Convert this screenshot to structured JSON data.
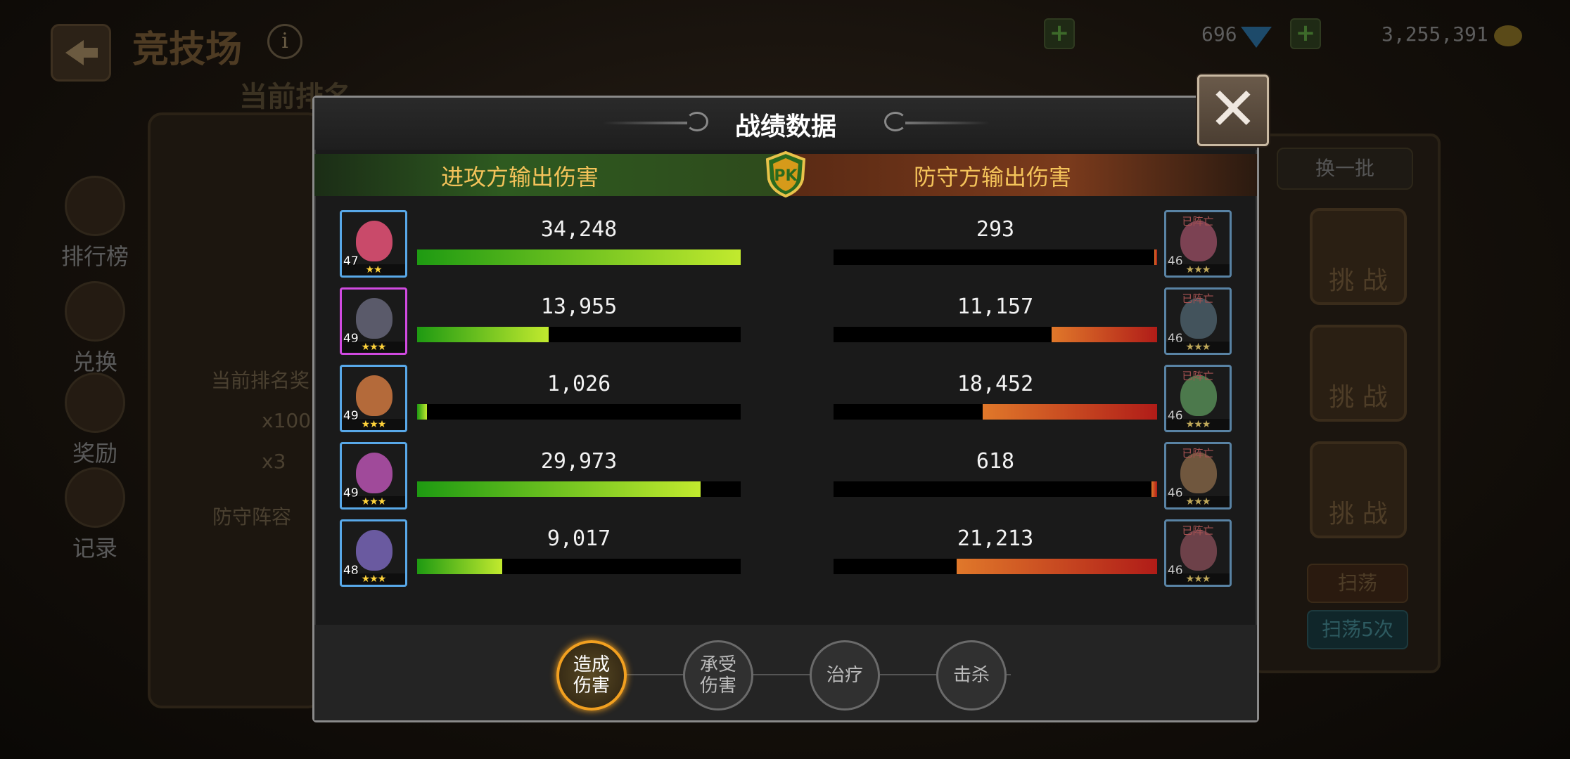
{
  "background": {
    "screen_title": "竞技场",
    "rank_banner": "当前排名",
    "resources": {
      "gems": "696",
      "gold": "3,255,391"
    },
    "left_menu": [
      {
        "label": "排行榜"
      },
      {
        "label": "兑换"
      },
      {
        "label": "奖励"
      },
      {
        "label": "记录"
      }
    ],
    "reward_heading": "当前排名奖",
    "reward_items": [
      {
        "qty": "x100"
      },
      {
        "qty": "x3"
      }
    ],
    "defense_heading": "防守阵容",
    "swap_label": "换一批",
    "challenge_label": "挑 战",
    "sweep_label": "扫荡",
    "sweep5_label": "扫荡5次"
  },
  "dialog": {
    "title": "战绩数据",
    "attacker_header": "进攻方输出伤害",
    "defender_header": "防守方输出伤害",
    "pk_label": "PK",
    "close_label": "✕",
    "max_value": 34248,
    "rows": [
      {
        "attacker": {
          "level": "47",
          "stars": "★★",
          "value": 34248,
          "value_text": "34,248",
          "border": "blue",
          "face": "#c94a6a"
        },
        "defender": {
          "level": "46",
          "stars": "★★★",
          "value": 293,
          "value_text": "293",
          "status": "已阵亡",
          "face": "#b84a6a"
        }
      },
      {
        "attacker": {
          "level": "49",
          "stars": "★★★",
          "value": 13955,
          "value_text": "13,955",
          "border": "purple",
          "face": "#5a5a6a"
        },
        "defender": {
          "level": "46",
          "stars": "★★★",
          "value": 11157,
          "value_text": "11,157",
          "status": "已阵亡",
          "face": "#4a6a7a"
        }
      },
      {
        "attacker": {
          "level": "49",
          "stars": "★★★",
          "value": 1026,
          "value_text": "1,026",
          "border": "blue",
          "face": "#b46a3a"
        },
        "defender": {
          "level": "46",
          "stars": "★★★",
          "value": 18452,
          "value_text": "18,452",
          "status": "已阵亡",
          "face": "#4aa04a"
        }
      },
      {
        "attacker": {
          "level": "49",
          "stars": "★★★",
          "value": 29973,
          "value_text": "29,973",
          "border": "blue",
          "face": "#a04a9a"
        },
        "defender": {
          "level": "46",
          "stars": "★★★",
          "value": 618,
          "value_text": "618",
          "status": "已阵亡",
          "face": "#9a6a3a"
        }
      },
      {
        "attacker": {
          "level": "48",
          "stars": "★★★",
          "value": 9017,
          "value_text": "9,017",
          "border": "blue",
          "face": "#6a5aa0"
        },
        "defender": {
          "level": "46",
          "stars": "★★★",
          "value": 21213,
          "value_text": "21,213",
          "status": "已阵亡",
          "face": "#a04a5a"
        }
      }
    ],
    "tabs": [
      {
        "label": "造成\n伤害",
        "active": true
      },
      {
        "label": "承受\n伤害",
        "active": false
      },
      {
        "label": "治疗",
        "active": false
      },
      {
        "label": "击杀",
        "active": false
      }
    ]
  },
  "colors": {
    "attacker_bar": "#7cc21e",
    "defender_bar": "#c8301e",
    "header_text": "#f4c35a",
    "active_tab": "#f2a020"
  }
}
